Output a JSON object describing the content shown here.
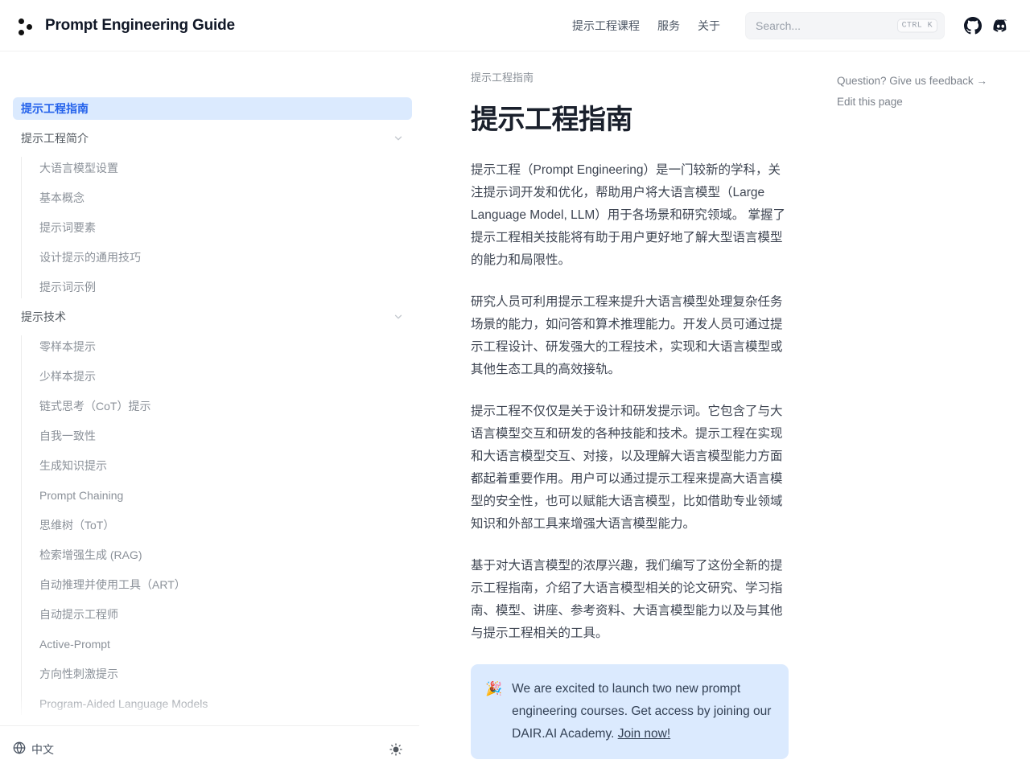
{
  "header": {
    "brand_title": "Prompt Engineering Guide",
    "logo_icon": "three-dots-logo-icon",
    "nav_links": [
      {
        "label": "提示工程课程"
      },
      {
        "label": "服务"
      },
      {
        "label": "关于"
      }
    ],
    "search": {
      "placeholder": "Search...",
      "value": "",
      "shortcut": "CTRL K"
    },
    "github_icon": "github-icon",
    "discord_icon": "discord-icon"
  },
  "sidebar": {
    "active_label": "提示工程指南",
    "sections": [
      {
        "label": "提示工程指南",
        "active": true,
        "collapsible": false,
        "children": []
      },
      {
        "label": "提示工程简介",
        "active": false,
        "collapsible": true,
        "children": [
          {
            "label": "大语言模型设置"
          },
          {
            "label": "基本概念"
          },
          {
            "label": "提示词要素"
          },
          {
            "label": "设计提示的通用技巧"
          },
          {
            "label": "提示词示例"
          }
        ]
      },
      {
        "label": "提示技术",
        "active": false,
        "collapsible": true,
        "children": [
          {
            "label": "零样本提示"
          },
          {
            "label": "少样本提示"
          },
          {
            "label": "链式思考（CoT）提示"
          },
          {
            "label": "自我一致性"
          },
          {
            "label": "生成知识提示"
          },
          {
            "label": "Prompt Chaining"
          },
          {
            "label": "思维树（ToT）"
          },
          {
            "label": "检索增强生成 (RAG)"
          },
          {
            "label": "自动推理并使用工具（ART）"
          },
          {
            "label": "自动提示工程师"
          },
          {
            "label": "Active-Prompt"
          },
          {
            "label": "方向性刺激提示"
          },
          {
            "label": "Program-Aided Language Models"
          }
        ]
      }
    ],
    "footer": {
      "language_label": "中文",
      "globe_icon": "globe-icon",
      "theme_icon": "sun-icon"
    }
  },
  "main": {
    "breadcrumb": "提示工程指南",
    "title": "提示工程指南",
    "paragraphs": [
      "提示工程（Prompt Engineering）是一门较新的学科，关注提示词开发和优化，帮助用户将大语言模型（Large Language Model, LLM）用于各场景和研究领域。 掌握了提示工程相关技能将有助于用户更好地了解大型语言模型的能力和局限性。",
      "研究人员可利用提示工程来提升大语言模型处理复杂任务场景的能力，如问答和算术推理能力。开发人员可通过提示工程设计、研发强大的工程技术，实现和大语言模型或其他生态工具的高效接轨。",
      "提示工程不仅仅是关于设计和研发提示词。它包含了与大语言模型交互和研发的各种技能和技术。提示工程在实现和大语言模型交互、对接，以及理解大语言模型能力方面都起着重要作用。用户可以通过提示工程来提高大语言模型的安全性，也可以赋能大语言模型，比如借助专业领域知识和外部工具来增强大语言模型能力。",
      "基于对大语言模型的浓厚兴趣，我们编写了这份全新的提示工程指南，介绍了大语言模型相关的论文研究、学习指南、模型、讲座、参考资料、大语言模型能力以及与其他与提示工程相关的工具。"
    ],
    "callout": {
      "emoji": "🎉",
      "text": "We are excited to launch two new prompt engineering courses. Get access by joining our DAIR.AI Academy. ",
      "link_label": "Join now!"
    }
  },
  "right_rail": {
    "links": [
      {
        "label": "Question? Give us feedback →"
      },
      {
        "label": "Edit this page"
      }
    ]
  },
  "colors": {
    "accent": "#2563eb",
    "active_bg": "#dbeafe",
    "callout_bg": "#dbeafe",
    "text": "#3e4552",
    "muted": "#8b9199"
  }
}
